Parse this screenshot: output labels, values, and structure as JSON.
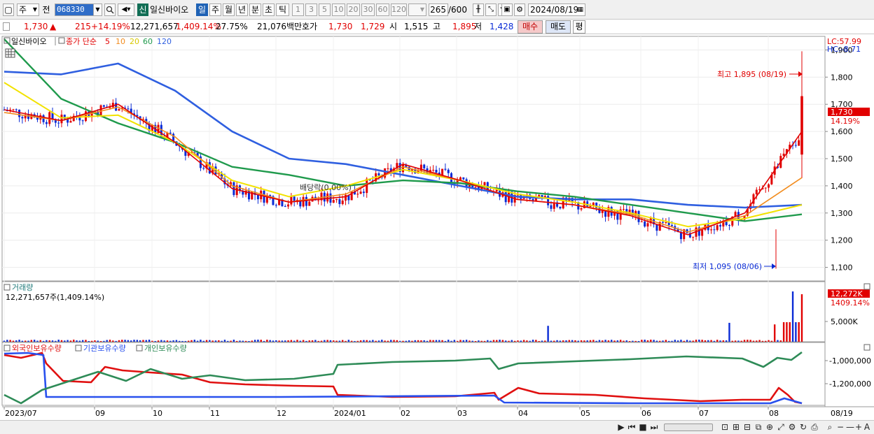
{
  "toolbar": {
    "market": "주",
    "prefix": "전",
    "code": "068330",
    "badge": "신",
    "stock_name": "일신바이오",
    "periods": [
      "일",
      "주",
      "월",
      "년",
      "분",
      "초",
      "틱"
    ],
    "active_period": "일",
    "intervals": [
      "1",
      "3",
      "5",
      "10",
      "20",
      "30",
      "60",
      "120"
    ],
    "count": "265",
    "count_max": "/600",
    "date": "2024/08/19"
  },
  "quote": {
    "price": "1,730",
    "arrow": "▲",
    "change": "215",
    "change_pct": "+14.19%",
    "volume": "12,271,657",
    "volume_pct": "1,409.14%",
    "turnover": "27.75%",
    "trade_value": "21,076백만",
    "hoga_label": "호가",
    "ask": "1,730",
    "bid": "1,729",
    "open_label": "시",
    "open": "1,515",
    "high_label": "고",
    "high": "1,895",
    "low_label": "저",
    "low": "1,428",
    "buy_label": "매수",
    "sell_label": "매도",
    "avg_label": "평"
  },
  "price_panel": {
    "legend_name": "일신바이오",
    "legend_ma_label": "종가 단순",
    "legend_ma_periods": [
      "5",
      "10",
      "20",
      "60",
      "120"
    ],
    "lc_label": "LC:57.99",
    "hc_label": "HC:-8.71",
    "y_ticks": [
      "1,900",
      "1,800",
      "1,700",
      "1,600",
      "1,500",
      "1,400",
      "1,300",
      "1,200",
      "1,100"
    ],
    "current_tag": "1,730",
    "current_pct": "14.19%",
    "high_annotation": "최고 1,895 (08/19)",
    "low_annotation": "최저 1,095 (08/06)",
    "overlay_label": "배당락(0.00%)"
  },
  "volume_panel": {
    "title": "거래량",
    "subtitle": "12,271,657주(1,409.14%)",
    "tag_value": "12,272K",
    "tag_pct": "1409.14%",
    "y_tick": "5,000K"
  },
  "holdings_panel": {
    "legend": [
      "외국인보유수량",
      "기관보유수량",
      "개인보유수량"
    ],
    "y_ticks": [
      "-1,000,000",
      "-1,200,000"
    ]
  },
  "x_axis": {
    "labels": [
      "2023/07",
      "09",
      "10",
      "11",
      "12",
      "2024/01",
      "02",
      "03",
      "04",
      "05",
      "06",
      "07",
      "08"
    ],
    "end_label": "08/19"
  },
  "colors": {
    "up": "#e10000",
    "down": "#0a2bd6",
    "ma5": "#e10000",
    "ma10": "#f28c1e",
    "ma20": "#f2e200",
    "ma60": "#1f9a4c",
    "ma120": "#2f5fe0",
    "foreign": "#e01010",
    "institution": "#2850ee",
    "individual": "#2e8b57"
  },
  "chart_data": {
    "type": "candlestick",
    "x": [
      "2023/07",
      "09",
      "10",
      "11",
      "12",
      "2024/01",
      "02",
      "03",
      "04",
      "05",
      "06",
      "07",
      "08",
      "08/19"
    ],
    "ylim": [
      1050,
      1950
    ],
    "series": [
      {
        "name": "5",
        "values": [
          1680,
          1640,
          1700,
          1560,
          1390,
          1340,
          1360,
          1480,
          1420,
          1350,
          1330,
          1290,
          1220,
          1300,
          1600
        ]
      },
      {
        "name": "10",
        "values": [
          1670,
          1640,
          1690,
          1580,
          1400,
          1340,
          1370,
          1470,
          1420,
          1350,
          1330,
          1295,
          1230,
          1290,
          1430
        ]
      },
      {
        "name": "20",
        "values": [
          1780,
          1650,
          1660,
          1560,
          1420,
          1360,
          1400,
          1460,
          1420,
          1370,
          1340,
          1300,
          1250,
          1280,
          1330
        ]
      },
      {
        "name": "60",
        "values": [
          1940,
          1720,
          1630,
          1560,
          1470,
          1440,
          1400,
          1420,
          1410,
          1380,
          1360,
          1330,
          1300,
          1270,
          1295
        ]
      },
      {
        "name": "120",
        "values": [
          1820,
          1810,
          1850,
          1750,
          1600,
          1500,
          1480,
          1440,
          1400,
          1360,
          1350,
          1350,
          1330,
          1320,
          1330
        ]
      }
    ],
    "annotations": {
      "high": 1895,
      "low": 1095,
      "last": 1730
    }
  }
}
